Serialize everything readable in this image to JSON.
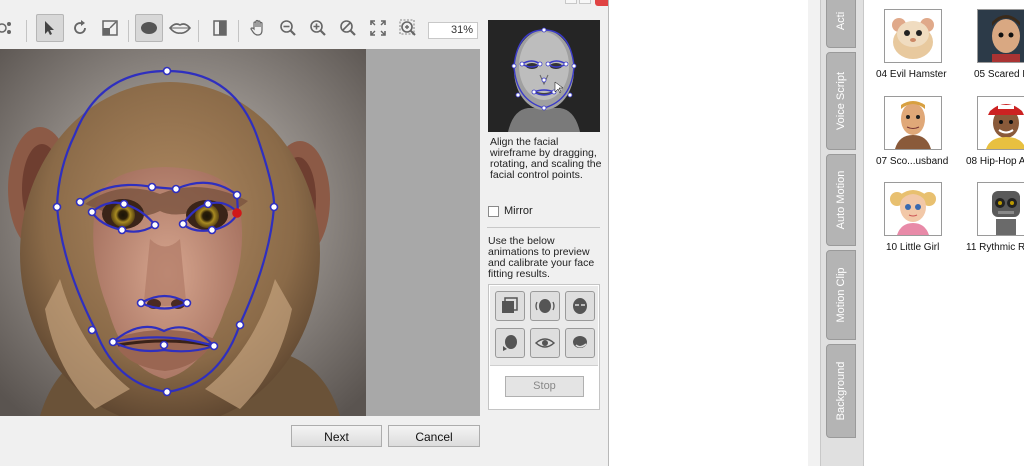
{
  "toolbar": {
    "zoom_value": "31%",
    "icons": [
      "connect-icon",
      "select-arrow-icon",
      "rotate-icon",
      "scale-icon",
      "face-outline-icon",
      "lips-icon",
      "frame-icon",
      "hand-icon",
      "zoom-out-icon",
      "zoom-in-icon",
      "zoom-reset-icon",
      "fit-screen-icon",
      "zoom-region-icon"
    ]
  },
  "panel": {
    "instruction": "Align the facial wireframe by dragging, rotating, and scaling the facial control points.",
    "mirror_label": "Mirror",
    "mirror_checked": false,
    "preview_text": "Use the below animations to preview and calibrate your face fitting results.",
    "stop_label": "Stop"
  },
  "footer": {
    "next_label": "Next",
    "cancel_label": "Cancel"
  },
  "side_tabs": [
    {
      "label": "Acti"
    },
    {
      "label": "Voice Script"
    },
    {
      "label": "Auto Motion"
    },
    {
      "label": "Motion Clip"
    },
    {
      "label": "Background"
    }
  ],
  "library": {
    "items": [
      {
        "label": "04 Evil Hamster"
      },
      {
        "label": "05 Scared B"
      },
      {
        "label": "07 Sco...usband"
      },
      {
        "label": "08 Hip-Hop A"
      },
      {
        "label": "10 Little Girl"
      },
      {
        "label": "11 Rythmic R"
      }
    ]
  },
  "colors": {
    "wireframe": "#2f2fbf",
    "control_point_selected": "#d01818",
    "accent_close": "#e04343"
  }
}
